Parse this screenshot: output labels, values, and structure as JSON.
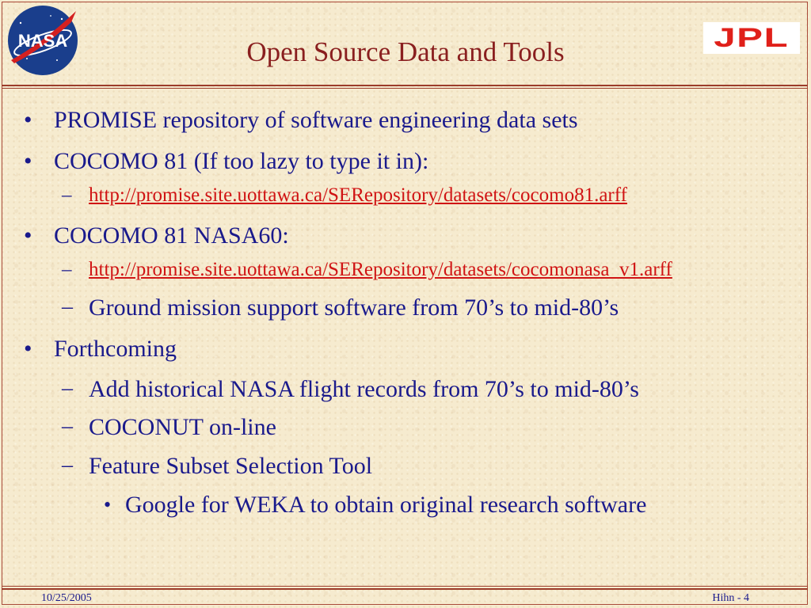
{
  "slide": {
    "title": "Open Source Data and Tools",
    "logos": {
      "left": "NASA",
      "right": "JPL"
    },
    "items": [
      {
        "marker": "•",
        "text": "PROMISE repository of software engineering data sets"
      },
      {
        "marker": "•",
        "text": "COCOMO 81 (If too lazy to type it in):"
      },
      {
        "marker": "–",
        "text": "http://promise.site.uottawa.ca/SERepository/datasets/cocomo81.arff"
      },
      {
        "marker": "•",
        "text": "COCOMO 81 NASA60:"
      },
      {
        "marker": "–",
        "text": "http://promise.site.uottawa.ca/SERepository/datasets/cocomonasa_v1.arff"
      },
      {
        "marker": "–",
        "text": "Ground mission support software from 70’s to mid-80’s"
      },
      {
        "marker": "•",
        "text": "Forthcoming"
      },
      {
        "marker": "–",
        "text": "Add historical NASA flight records from 70’s to mid-80’s"
      },
      {
        "marker": "–",
        "text": "COCONUT on-line"
      },
      {
        "marker": "–",
        "text": "Feature Subset Selection Tool"
      },
      {
        "marker": "•",
        "text": "Google for WEKA  to obtain original research software"
      }
    ],
    "footer": {
      "date": "10/25/2005",
      "page": "Hihn - 4"
    }
  },
  "colors": {
    "title": "#8a1f1f",
    "text": "#1a1a8c",
    "link": "#d01414",
    "rule": "#9c3c2a",
    "background": "#f6ebcf"
  }
}
